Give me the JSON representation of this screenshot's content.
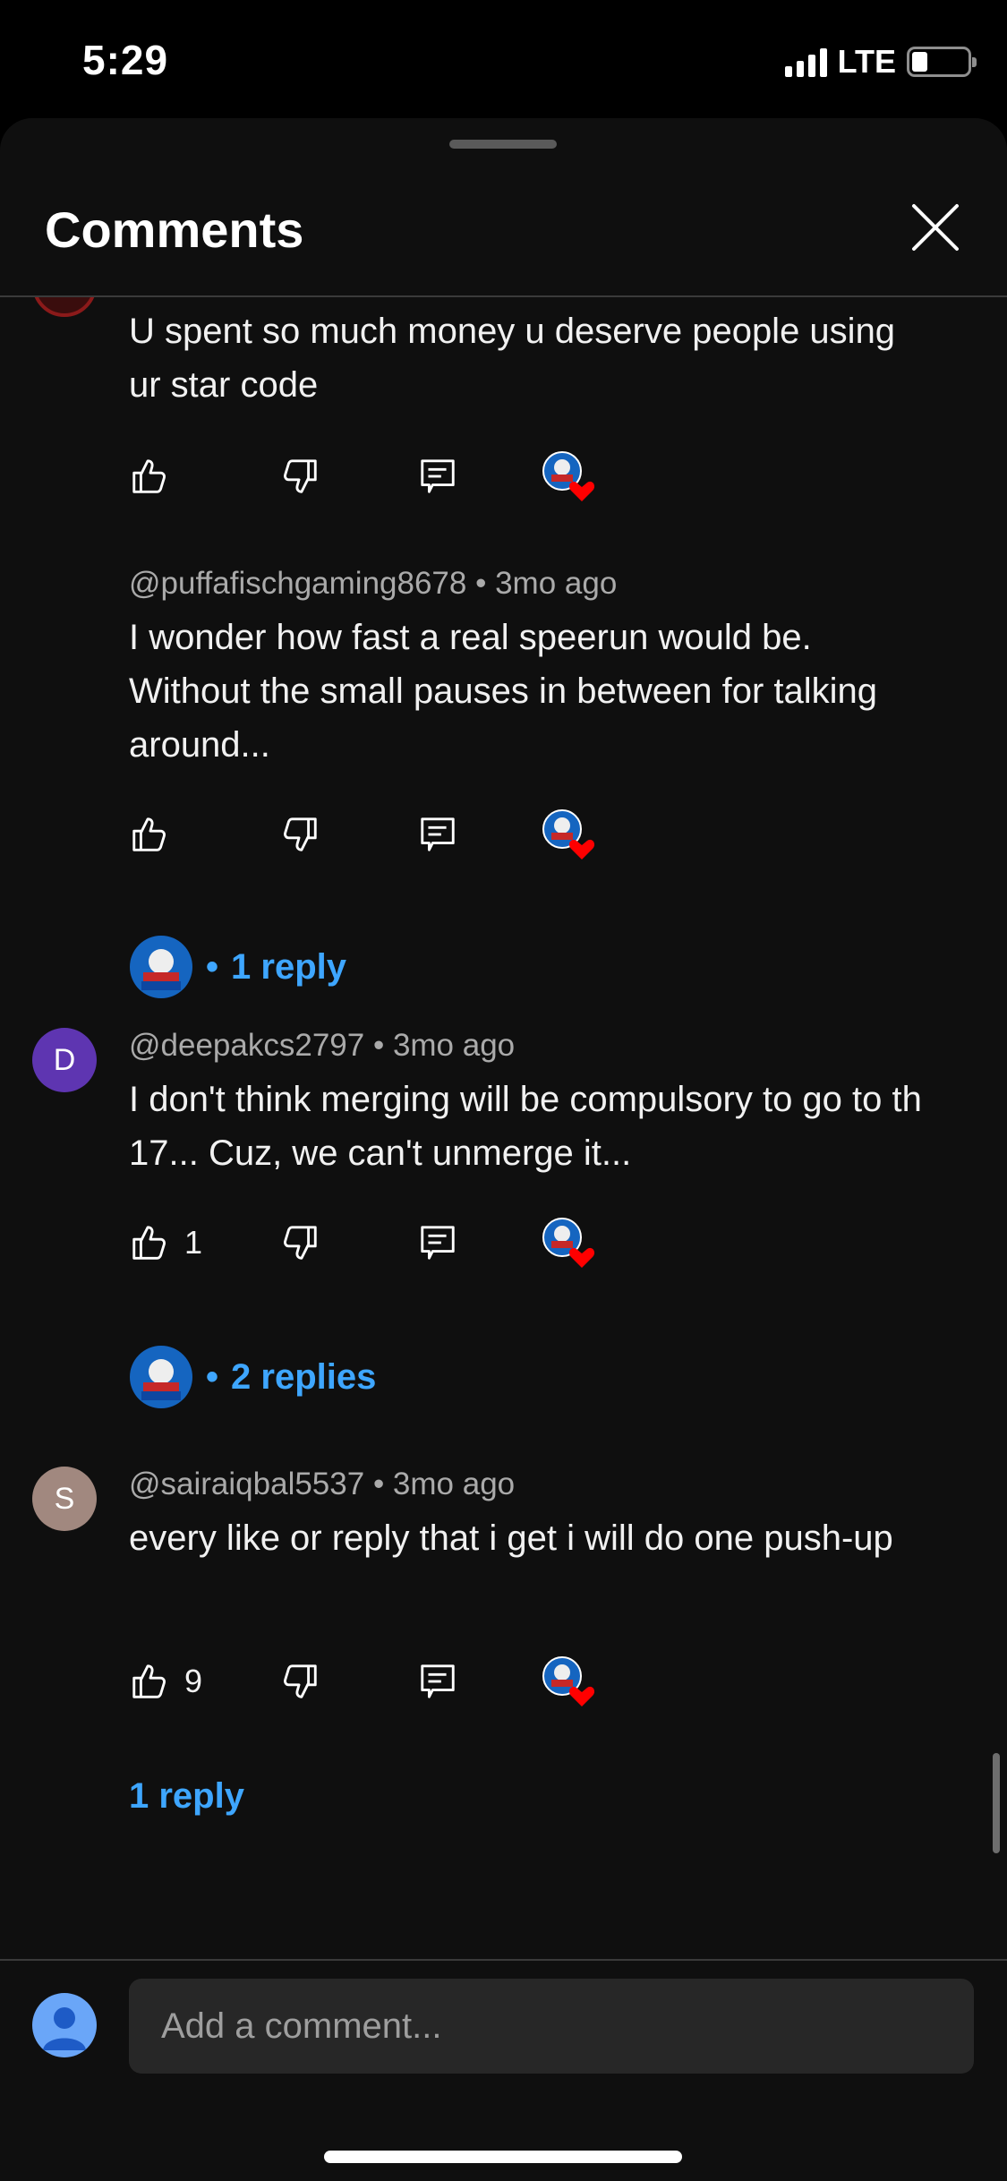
{
  "status_bar": {
    "time": "5:29",
    "network": "LTE"
  },
  "sheet": {
    "title": "Comments",
    "close_icon": "close-icon"
  },
  "comments": [
    {
      "author": "",
      "age": "",
      "text": "U spent so much money u deserve people using ur star code",
      "likes": "",
      "avatar_color": "#8b1a1a",
      "avatar_letter": "",
      "replies": ""
    },
    {
      "author": "@puffafischgaming8678",
      "age": "3mo ago",
      "text": "I wonder how fast a real speerun would be. Without the small pauses in between for talking around...",
      "likes": "",
      "avatar_color": "",
      "avatar_letter": "",
      "replies": "1 reply"
    },
    {
      "author": "@deepakcs2797",
      "age": "3mo ago",
      "text": "I don't think merging will be compulsory to go to th 17... Cuz, we can't unmerge it...",
      "likes": "1",
      "avatar_color": "#5e35b1",
      "avatar_letter": "D",
      "replies": "2 replies"
    },
    {
      "author": "@sairaiqbal5537",
      "age": "3mo ago",
      "text": "every like or reply that i get i will do one push-up",
      "likes": "9",
      "avatar_color": "#a1887f",
      "avatar_letter": "S",
      "replies": "1 reply"
    }
  ],
  "reply_prefix": "•",
  "input": {
    "placeholder": "Add a comment..."
  },
  "colors": {
    "background": "#0f0f0f",
    "link": "#3ea6ff",
    "heart": "#ff0000"
  }
}
